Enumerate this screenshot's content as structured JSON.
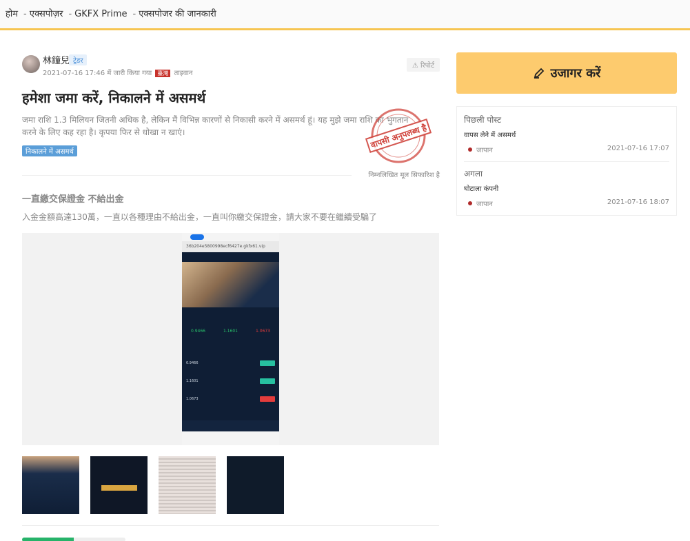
{
  "breadcrumb": {
    "home": "होम",
    "exposure": "एक्सपोज़र",
    "broker": "GKFX Prime",
    "current": "एक्सपोजर की जानकारी",
    "separator": "-"
  },
  "post": {
    "author": "林鐘兒",
    "role": "ट्रेडर",
    "date": "2021-07-16 17:46",
    "issued_by": "में जारी किया गया",
    "flag_text": "臺灣",
    "location": "ताइवान",
    "report": "रिपोर्ट",
    "title": "हमेशा जमा करें, निकालने में असमर्थ",
    "description": "जमा राशि 1.3 मिलियन जितनी अधिक है, लेकिन मैं विभिन्न कारणों से निकासी करने में असमर्थ हूं। यह मुझे जमा राशि का भुगतान करने के लिए कह रहा है। कृपया फिर से धोखा न खाएं।",
    "tag": "निकालने में असमर्थ",
    "stamp_text": "वापसी अनुपलब्ध है",
    "recommend": "निम्नलिखित मूल सिफारिश है",
    "original_title": "一直繳交保證金 不給出金",
    "original_text": "入金金額高達130萬，一直以各種理由不給出金，一直叫你繳交保證金，請大家不要在繼續受騙了",
    "phone_url": "36b204e5800998ecf6427e.gkfx61.vip",
    "phone_rates": [
      "0.9466",
      "1.1601",
      "1.0673"
    ]
  },
  "sidebar": {
    "expose_label": "उजागर करें",
    "prev_label": "पिछली पोस्ट",
    "prev_title": "वापस लेने में असमर्थ",
    "prev_location": "जापान",
    "prev_date": "2021-07-16 17:07",
    "next_label": "अगला",
    "next_title": "घोटाला कंपनी",
    "next_location": "जापान",
    "next_date": "2021-07-16 18:07"
  },
  "colors": {
    "accent": "#f6c552",
    "button": "#fdcb6e",
    "stamp": "#d0443c",
    "tag": "#5b9ed8"
  }
}
